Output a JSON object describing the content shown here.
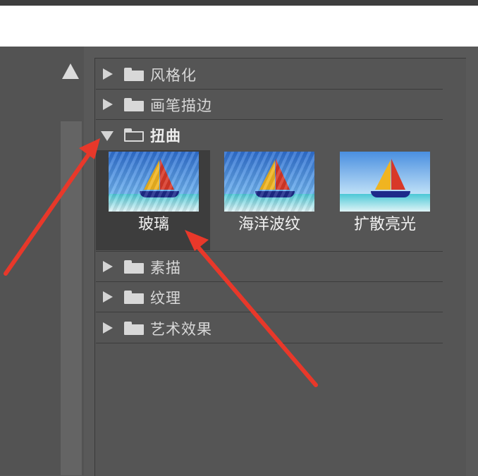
{
  "tree": {
    "categories": [
      {
        "label": "风格化",
        "expanded": false
      },
      {
        "label": "画笔描边",
        "expanded": false
      },
      {
        "label": "扭曲",
        "expanded": true
      },
      {
        "label": "素描",
        "expanded": false
      },
      {
        "label": "纹理",
        "expanded": false
      },
      {
        "label": "艺术效果",
        "expanded": false
      }
    ],
    "distort_filters": [
      {
        "label": "玻璃",
        "selected": true
      },
      {
        "label": "海洋波纹",
        "selected": false
      },
      {
        "label": "扩散亮光",
        "selected": false
      }
    ]
  },
  "colors": {
    "annotation_arrow": "#e8382a",
    "panel_bg": "#555555",
    "selected_bg": "#3d3d3d"
  }
}
